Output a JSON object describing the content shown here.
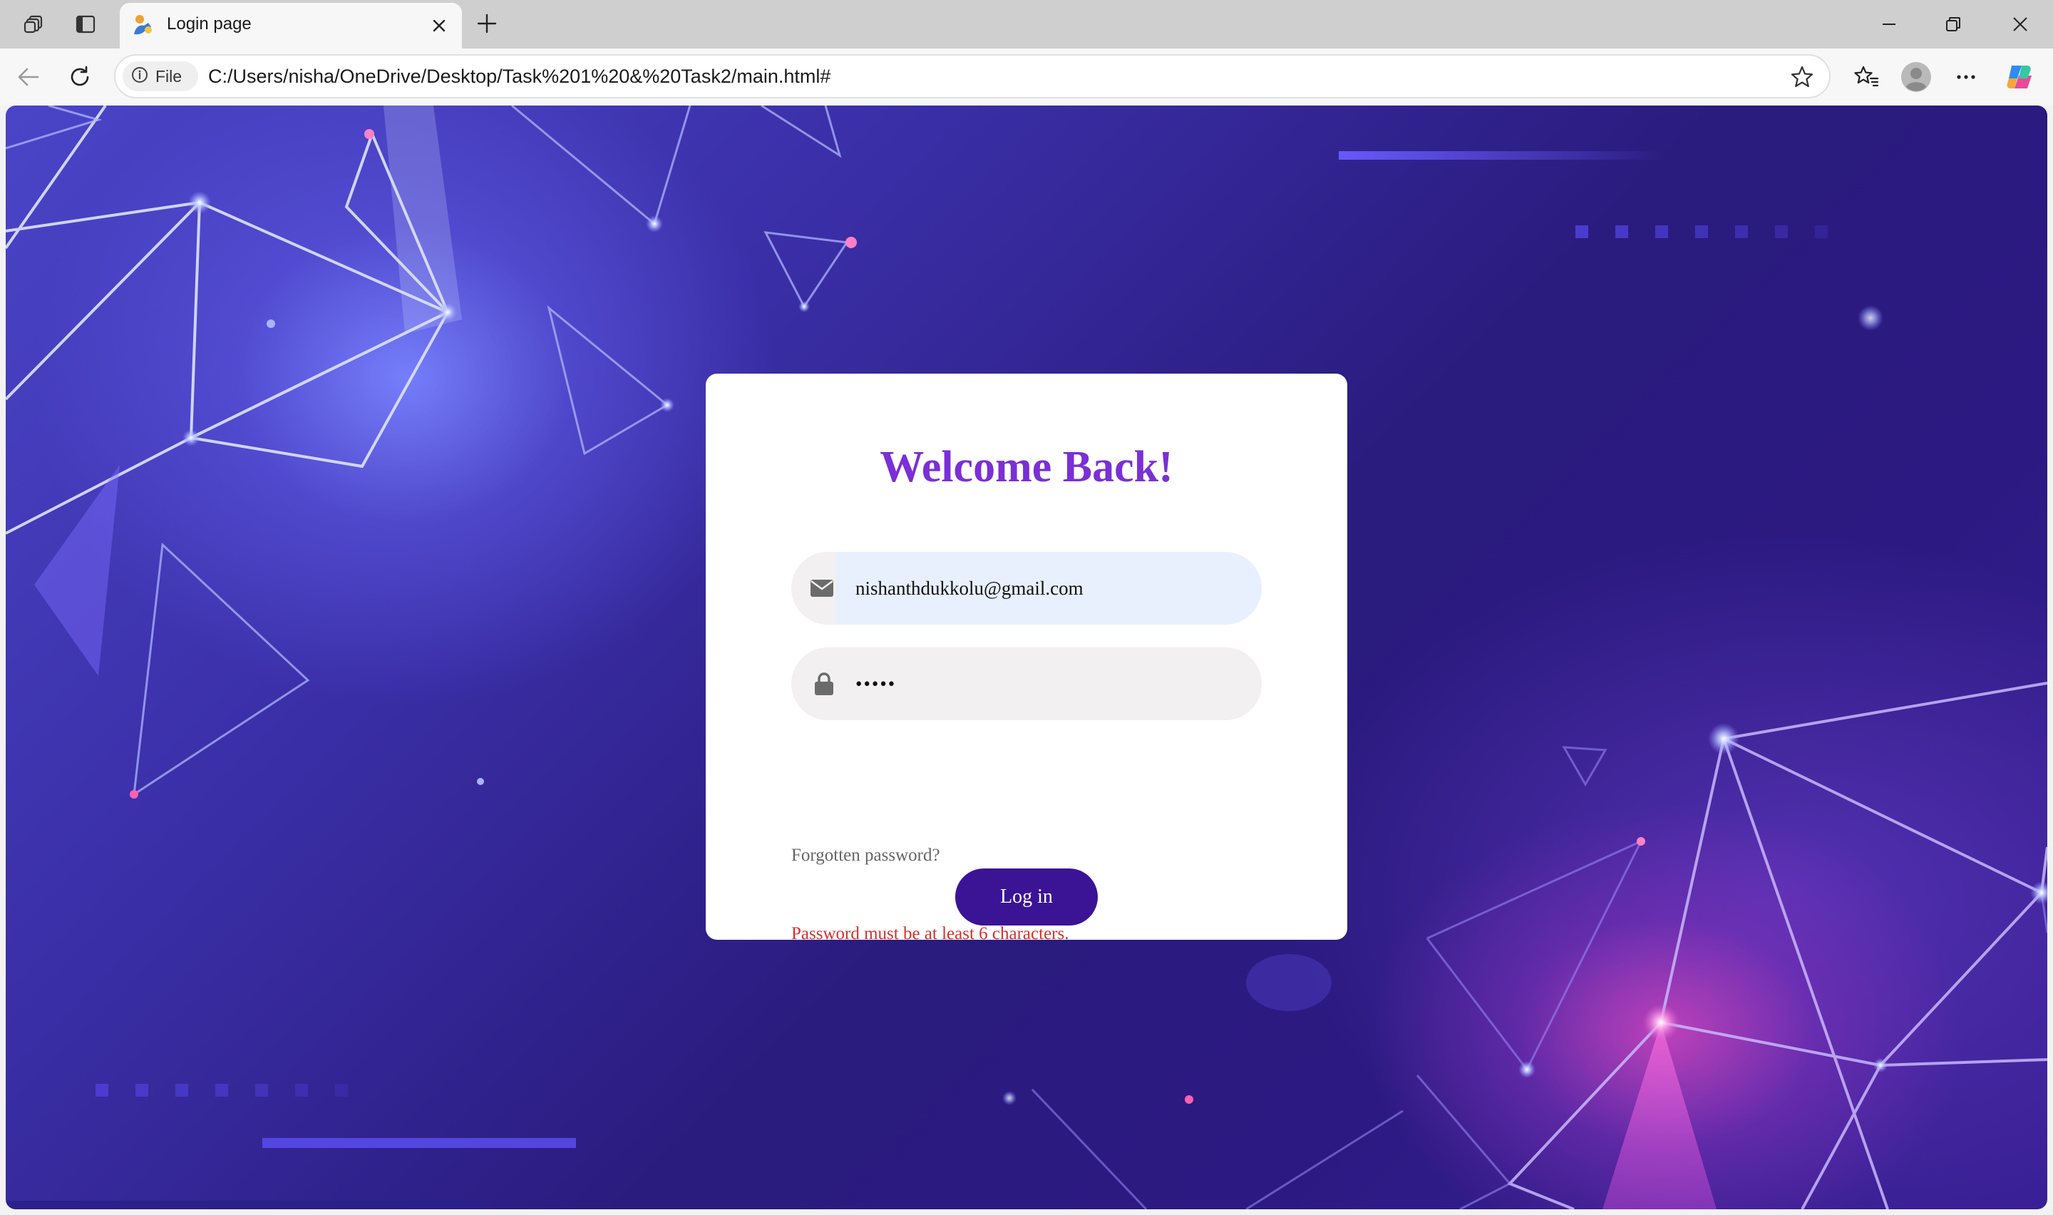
{
  "browser": {
    "tab": {
      "title": "Login page"
    },
    "address_bar": {
      "scheme_label": "File",
      "url": "C:/Users/nisha/OneDrive/Desktop/Task%201%20&%20Task2/main.html#"
    },
    "icons": {
      "workspaces": "workspaces-icon",
      "tab_actions": "vertical-tabs-icon",
      "close_tab": "close-icon",
      "new_tab": "plus-icon",
      "minimize": "minimize-icon",
      "restore": "restore-icon",
      "close_window": "close-icon",
      "back": "back-arrow-icon",
      "refresh": "refresh-icon",
      "info": "info-icon",
      "favorite": "star-icon",
      "favorites": "favorites-icon",
      "profile": "profile-icon",
      "more": "more-icon",
      "copilot": "copilot-icon"
    }
  },
  "login": {
    "title": "Welcome Back!",
    "email": {
      "value": "nishanthdukkolu@gmail.com",
      "icon": "envelope-icon"
    },
    "password": {
      "value": "•••••",
      "icon": "lock-icon"
    },
    "forgot_label": "Forgotten password?",
    "login_label": "Log in",
    "error": "Password must be at least 6 characters."
  },
  "colors": {
    "title": "#7b2fd6",
    "button": "#3b1495",
    "error": "#d9302a",
    "email_autofill_bg": "#e8f0fe"
  }
}
